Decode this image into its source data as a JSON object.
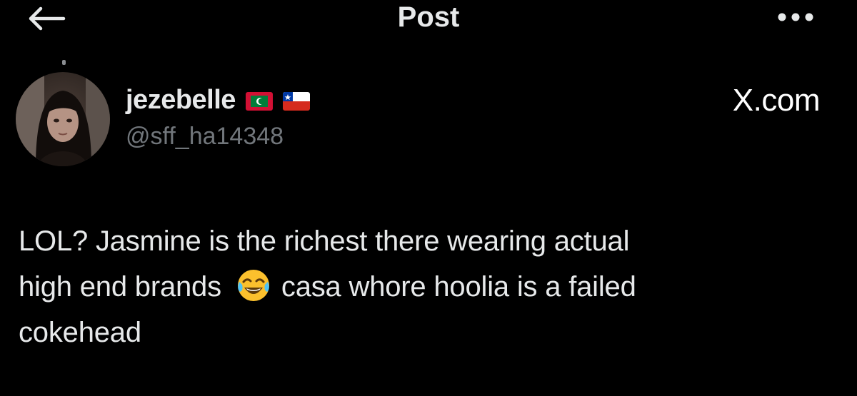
{
  "header": {
    "title": "Post",
    "back_icon": "arrow-left-icon",
    "more_icon": "more-horizontal-icon"
  },
  "author": {
    "display_name": "jezebelle",
    "handle": "@sff_ha14348",
    "flags": [
      "maldives-flag-icon",
      "chile-flag-icon"
    ]
  },
  "source_label": "X.com",
  "post": {
    "lines": [
      "LOL? Jasmine is the richest there wearing actual",
      "high end brands",
      "casa whore hoolia is a failed",
      "cokehead"
    ],
    "emoji": "face-with-tears-of-joy-icon"
  },
  "colors": {
    "background": "#000000",
    "text_primary": "#e7e9ea",
    "text_secondary": "#71767b"
  }
}
